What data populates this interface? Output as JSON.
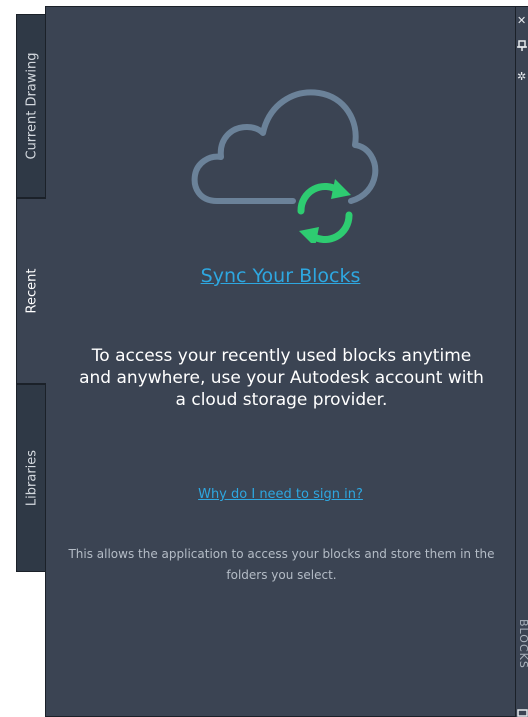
{
  "tabs": [
    {
      "label": "Current Drawing",
      "active": false
    },
    {
      "label": "Recent",
      "active": true
    },
    {
      "label": "Libraries",
      "active": false
    }
  ],
  "panel": {
    "sync_title": "Sync Your Blocks",
    "description": "To access your recently used blocks anytime and anywhere, use your Autodesk account with a cloud storage provider.",
    "why_link": "Why do I need to sign in?",
    "note": "This allows the application to access your blocks and store them in the folders you select.",
    "icon": "cloud-sync-icon",
    "link_color": "#2ea7e0",
    "sync_color": "#2ecc71"
  },
  "titlebar": {
    "title": "BLOCKS",
    "icons": [
      "close-icon",
      "pin-icon",
      "settings-icon"
    ]
  },
  "colors": {
    "panel_bg": "#3b4453",
    "tab_bg": "#2f3946",
    "border": "#1b2129"
  }
}
